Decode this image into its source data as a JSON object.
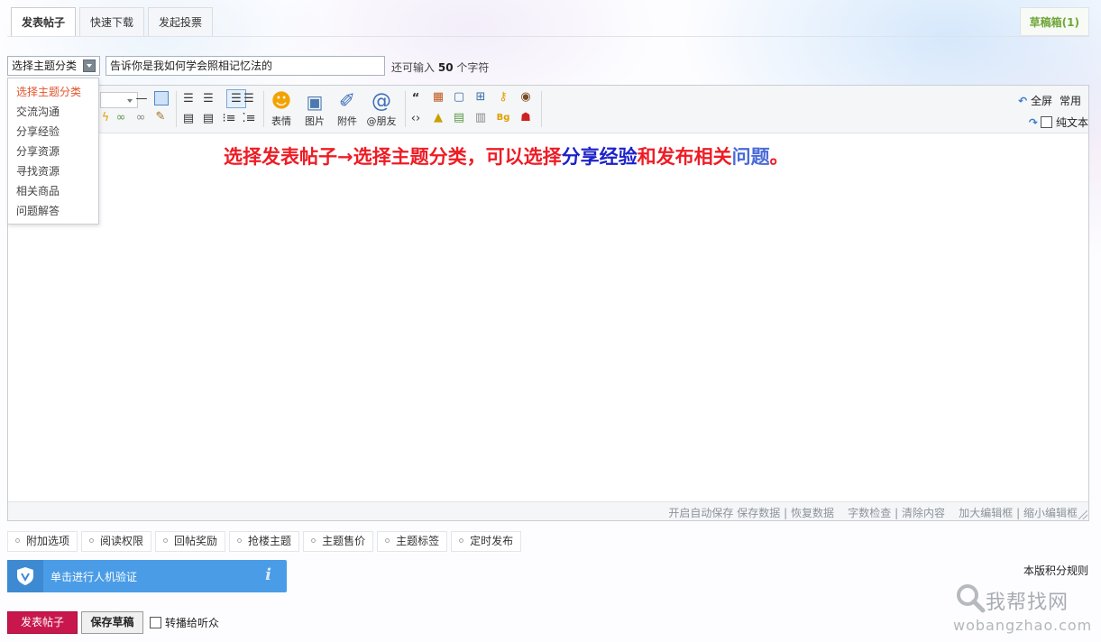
{
  "tabs": [
    {
      "label": "发表帖子",
      "active": true
    },
    {
      "label": "快速下载",
      "active": false
    },
    {
      "label": "发起投票",
      "active": false
    }
  ],
  "draft_box": "草稿箱(1)",
  "subject": {
    "category_selected": "选择主题分类",
    "title_value": "告诉你是我如何学会照相记忆法的",
    "remaining_prefix": "还可输入",
    "remaining_count": "50",
    "remaining_suffix": "个字符"
  },
  "category_dropdown": {
    "options": [
      "选择主题分类",
      "交流沟通",
      "分享经验",
      "分享资源",
      "寻找资源",
      "相关商品",
      "问题解答"
    ]
  },
  "toolbar": {
    "emoji_label": "表情",
    "image_label": "图片",
    "attach_label": "附件",
    "mention_label": "@朋友",
    "fullscreen_label": "全屏",
    "common_label": "常用",
    "plaintext_label": "纯文本"
  },
  "editor_content": {
    "part1": "选择发表帖子→选择主题分类，可以选择",
    "part2": "分享经验",
    "part3": "和发布相关",
    "part4": "问题",
    "part5": "。"
  },
  "editor_footer": {
    "autosave": "开启自动保存",
    "save_data": "保存数据",
    "restore_data": "恢复数据",
    "word_check": "字数检查",
    "clear": "清除内容",
    "enlarge": "加大编辑框",
    "shrink": "缩小编辑框",
    "separator": "|"
  },
  "extra_options": [
    "附加选项",
    "阅读权限",
    "回帖奖励",
    "抢楼主题",
    "主题售价",
    "主题标签",
    "定时发布"
  ],
  "captcha": {
    "text": "单击进行人机验证",
    "info": "i"
  },
  "rules_link": "本版积分规则",
  "actions": {
    "post": "发表帖子",
    "save_draft": "保存草稿",
    "broadcast": "转播给听众"
  },
  "watermark": {
    "brand": "我帮找网",
    "url": "wobangzhao.com"
  },
  "colors": {
    "accent_red": "#ee1c25",
    "accent_blue": "#1d22c8",
    "post_button": "#c8174c",
    "captcha_blue": "#4a9ce6",
    "draft_green": "#6fa63a"
  }
}
